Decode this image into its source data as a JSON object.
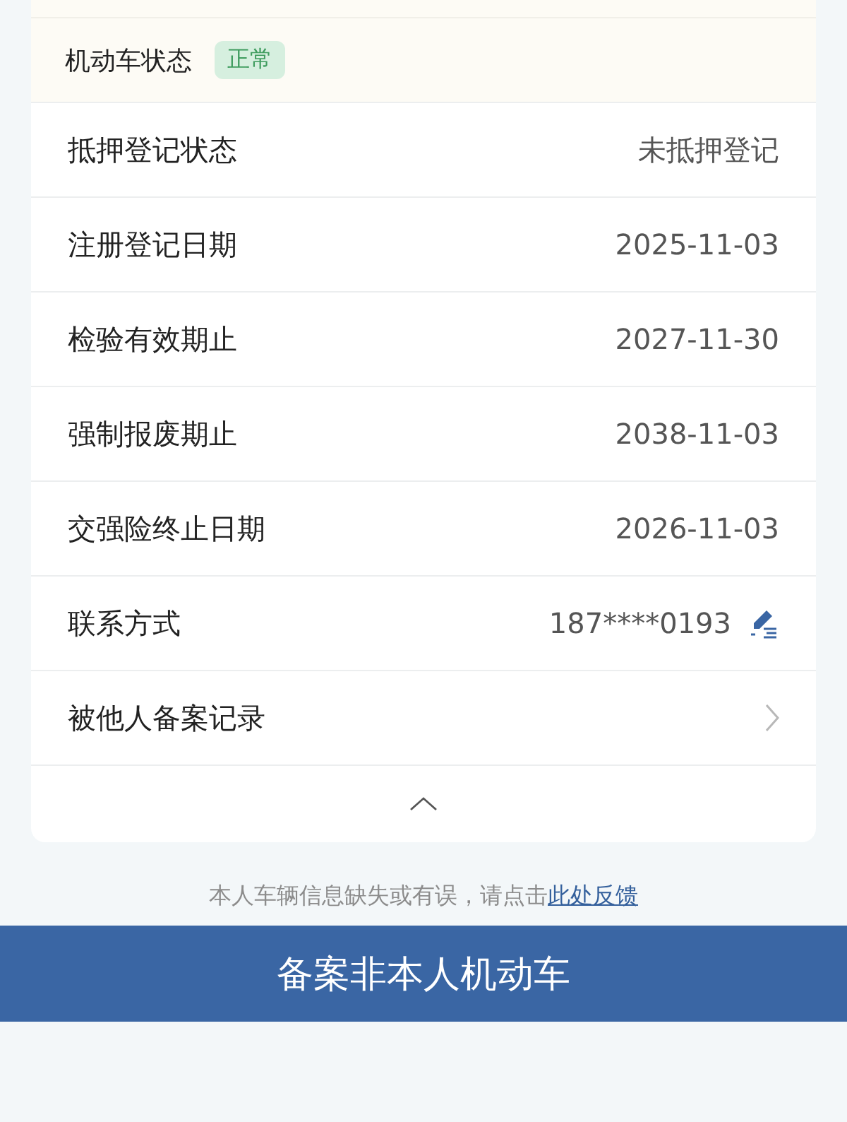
{
  "vehicle_status": {
    "label": "机动车状态",
    "badge": "正常"
  },
  "rows": [
    {
      "kind": "value",
      "label": "抵押登记状态",
      "value": "未抵押登记"
    },
    {
      "kind": "value",
      "label": "注册登记日期",
      "value": "2025-11-03"
    },
    {
      "kind": "value",
      "label": "检验有效期止",
      "value": "2027-11-30"
    },
    {
      "kind": "value",
      "label": "强制报废期止",
      "value": "2038-11-03"
    },
    {
      "kind": "value",
      "label": "交强险终止日期",
      "value": "2026-11-03"
    },
    {
      "kind": "edit",
      "label": "联系方式",
      "value": "187****0193"
    },
    {
      "kind": "link",
      "label": "被他人备案记录"
    }
  ],
  "feedback": {
    "text": "本人车辆信息缺失或有误，请点击",
    "link": "此处反馈"
  },
  "primary_button": "备案非本人机动车"
}
